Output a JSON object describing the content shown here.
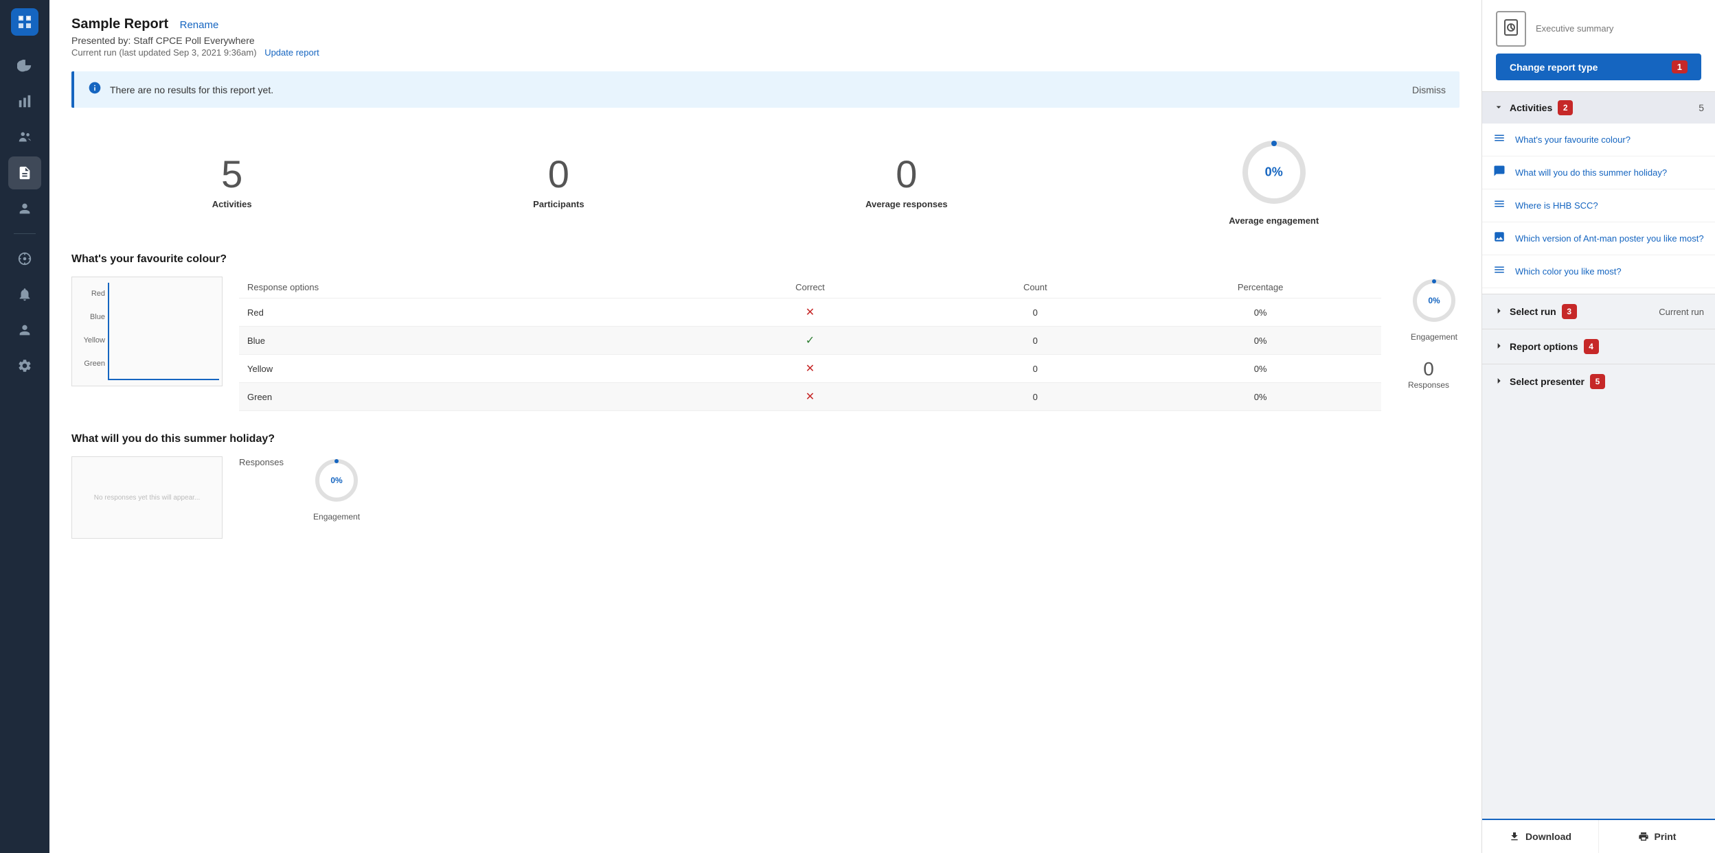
{
  "sidebar": {
    "logo_label": "Poll Everywhere",
    "items": [
      {
        "id": "dashboard",
        "label": "Dashboard",
        "active": false
      },
      {
        "id": "analytics",
        "label": "Analytics",
        "active": false
      },
      {
        "id": "participants",
        "label": "Participants",
        "active": false
      },
      {
        "id": "reports",
        "label": "Reports",
        "active": true
      },
      {
        "id": "presenter",
        "label": "Presenter",
        "active": false
      }
    ],
    "bottom_items": [
      {
        "id": "support",
        "label": "Support"
      },
      {
        "id": "notifications",
        "label": "Notifications"
      },
      {
        "id": "profile",
        "label": "Profile"
      },
      {
        "id": "settings",
        "label": "Settings"
      }
    ]
  },
  "report": {
    "title": "Sample Report",
    "rename_label": "Rename",
    "presenter": "Presented by: Staff CPCE Poll Everywhere",
    "last_updated": "Current run (last updated Sep 3, 2021 9:36am)",
    "update_link": "Update report"
  },
  "banner": {
    "text": "There are no results for this report yet.",
    "dismiss_label": "Dismiss"
  },
  "stats": {
    "activities_count": "5",
    "activities_label": "Activities",
    "participants_count": "0",
    "participants_label": "Participants",
    "avg_responses_count": "0",
    "avg_responses_label": "Average responses",
    "avg_engagement_percent": "0%",
    "avg_engagement_label": "Average engagement"
  },
  "question1": {
    "title": "What's your favourite colour?",
    "table": {
      "headers": [
        "Response options",
        "Correct",
        "Count",
        "Percentage"
      ],
      "rows": [
        {
          "option": "Red",
          "correct": false,
          "count": "0",
          "percentage": "0%"
        },
        {
          "option": "Blue",
          "correct": true,
          "count": "0",
          "percentage": "0%"
        },
        {
          "option": "Yellow",
          "correct": false,
          "count": "0",
          "percentage": "0%"
        },
        {
          "option": "Green",
          "correct": false,
          "count": "0",
          "percentage": "0%"
        }
      ]
    },
    "chart_labels": [
      "Red",
      "Blue",
      "Yellow",
      "Green"
    ],
    "engagement_percent": "0%",
    "engagement_label": "Engagement",
    "responses_count": "0",
    "responses_label": "Responses"
  },
  "question2": {
    "title": "What will you do this summer holiday?",
    "responses_label": "Responses",
    "engagement_percent": "0%",
    "engagement_label": "Engagement"
  },
  "right_panel": {
    "header": {
      "title": "Executive summary",
      "change_btn_label": "Change report type",
      "badge": "1"
    },
    "activities": {
      "title": "Activities",
      "count": "5",
      "badge": "2",
      "items": [
        {
          "icon": "list",
          "label": "What's your favourite colour?"
        },
        {
          "icon": "chat",
          "label": "What will you do this summer holiday?"
        },
        {
          "icon": "list",
          "label": "Where is HHB SCC?"
        },
        {
          "icon": "image",
          "label": "Which version of Ant-man poster you like most?"
        },
        {
          "icon": "list",
          "label": "Which color you like most?"
        }
      ]
    },
    "select_run": {
      "title": "Select run",
      "value": "Current run",
      "badge": "3"
    },
    "report_options": {
      "title": "Report options",
      "badge": "4"
    },
    "select_presenter": {
      "title": "Select presenter",
      "badge": "5"
    },
    "download_label": "Download",
    "print_label": "Print"
  }
}
